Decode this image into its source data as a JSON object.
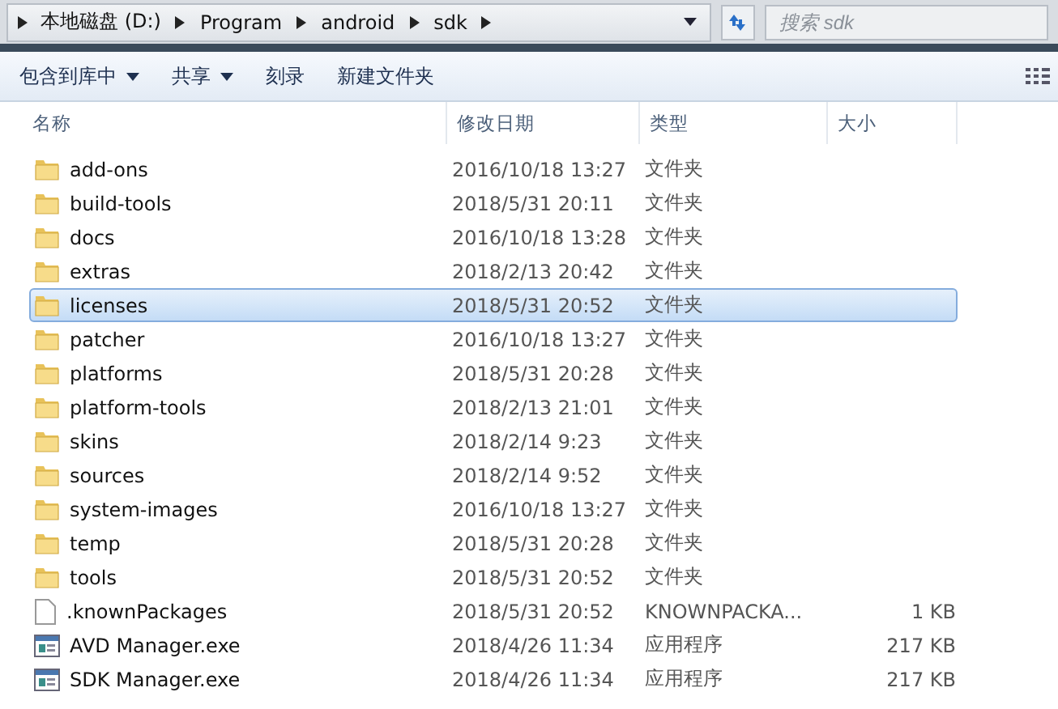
{
  "address_bar": {
    "crumbs": [
      "本地磁盘 (D:)",
      "Program",
      "android",
      "sdk"
    ]
  },
  "search": {
    "placeholder": "搜索 sdk"
  },
  "toolbar": [
    {
      "label": "包含到库中",
      "dropdown": true
    },
    {
      "label": "共享",
      "dropdown": true
    },
    {
      "label": "刻录",
      "dropdown": false
    },
    {
      "label": "新建文件夹",
      "dropdown": false
    }
  ],
  "columns": [
    "名称",
    "修改日期",
    "类型",
    "大小"
  ],
  "rows": [
    {
      "name": "add-ons",
      "date": "2016/10/18 13:27",
      "type": "文件夹",
      "kind": "folder",
      "selected": false
    },
    {
      "name": "build-tools",
      "date": "2018/5/31 20:11",
      "type": "文件夹",
      "kind": "folder",
      "selected": false
    },
    {
      "name": "docs",
      "date": "2016/10/18 13:28",
      "type": "文件夹",
      "kind": "folder",
      "selected": false
    },
    {
      "name": "extras",
      "date": "2018/2/13 20:42",
      "type": "文件夹",
      "kind": "folder",
      "selected": false
    },
    {
      "name": "licenses",
      "date": "2018/5/31 20:52",
      "type": "文件夹",
      "kind": "folder",
      "selected": true
    },
    {
      "name": "patcher",
      "date": "2016/10/18 13:27",
      "type": "文件夹",
      "kind": "folder",
      "selected": false
    },
    {
      "name": "platforms",
      "date": "2018/5/31 20:28",
      "type": "文件夹",
      "kind": "folder",
      "selected": false
    },
    {
      "name": "platform-tools",
      "date": "2018/2/13 21:01",
      "type": "文件夹",
      "kind": "folder",
      "selected": false
    },
    {
      "name": "skins",
      "date": "2018/2/14 9:23",
      "type": "文件夹",
      "kind": "folder",
      "selected": false
    },
    {
      "name": "sources",
      "date": "2018/2/14 9:52",
      "type": "文件夹",
      "kind": "folder",
      "selected": false
    },
    {
      "name": "system-images",
      "date": "2016/10/18 13:27",
      "type": "文件夹",
      "kind": "folder",
      "selected": false
    },
    {
      "name": "temp",
      "date": "2018/5/31 20:28",
      "type": "文件夹",
      "kind": "folder",
      "selected": false
    },
    {
      "name": "tools",
      "date": "2018/5/31 20:52",
      "type": "文件夹",
      "kind": "folder",
      "selected": false
    },
    {
      "name": ".knownPackages",
      "date": "2018/5/31 20:52",
      "type": "KNOWNPACKA...",
      "size": "1 KB",
      "kind": "file",
      "selected": false
    },
    {
      "name": "AVD Manager.exe",
      "date": "2018/4/26 11:34",
      "type": "应用程序",
      "size": "217 KB",
      "kind": "exe",
      "selected": false
    },
    {
      "name": "SDK Manager.exe",
      "date": "2018/4/26 11:34",
      "type": "应用程序",
      "size": "217 KB",
      "kind": "exe",
      "selected": false
    }
  ]
}
